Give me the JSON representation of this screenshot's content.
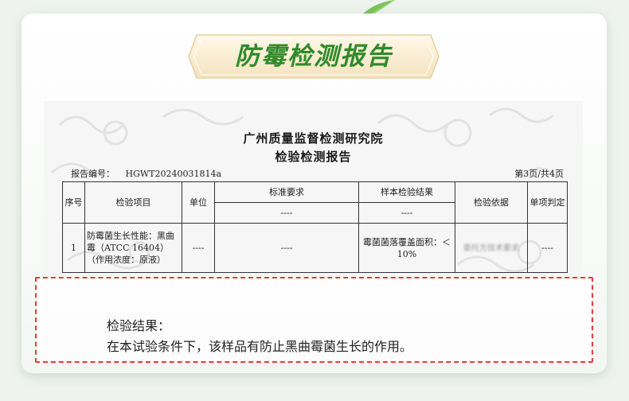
{
  "banner": {
    "title": "防霉检测报告"
  },
  "report": {
    "organization": "广州质量监督检测研究院",
    "doc_type": "检验检测报告",
    "report_no_label": "报告编号：",
    "report_no": "HGWT20240031814a",
    "page_info": "第3页/共4页",
    "headers": {
      "seq": "序号",
      "item": "检验项目",
      "unit": "单位",
      "standard": "标准要求",
      "result": "样本检验结果",
      "basis": "检验依据",
      "judgment": "单项判定"
    },
    "subheader_standard": "----",
    "subheader_result": "----",
    "row": {
      "seq": "1",
      "item": "防霉菌生长性能：黑曲霉（ATCC 16404）（作用浓度：原液）",
      "unit": "----",
      "standard": "----",
      "result": "霉菌菌落覆盖面积：＜10%",
      "basis": "委托方技术要求",
      "judgment": "----"
    }
  },
  "conclusion": {
    "label": "检验结果：",
    "text": "在本试验条件下，该样品有防止黑曲霉菌生长的作用。"
  },
  "colors": {
    "brand_green": "#2f8a2a",
    "dash_red": "#e23b3b"
  }
}
